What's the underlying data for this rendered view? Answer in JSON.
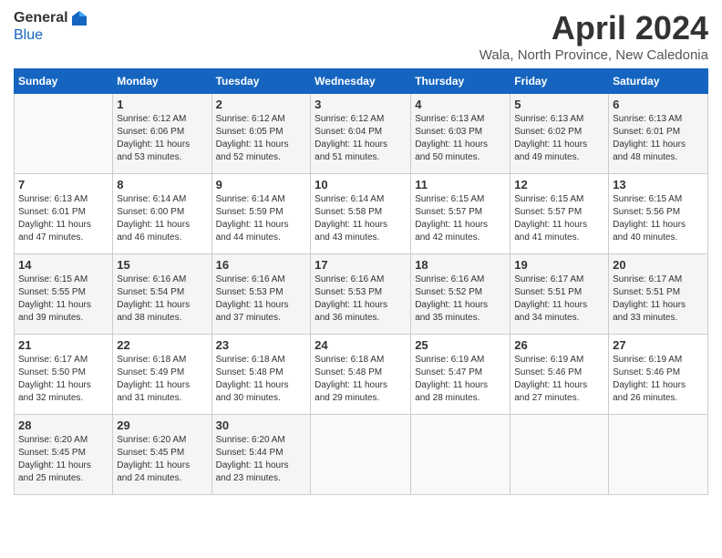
{
  "header": {
    "logo_general": "General",
    "logo_blue": "Blue",
    "month_title": "April 2024",
    "location": "Wala, North Province, New Caledonia"
  },
  "days_of_week": [
    "Sunday",
    "Monday",
    "Tuesday",
    "Wednesday",
    "Thursday",
    "Friday",
    "Saturday"
  ],
  "weeks": [
    [
      {
        "day": "",
        "info": ""
      },
      {
        "day": "1",
        "info": "Sunrise: 6:12 AM\nSunset: 6:06 PM\nDaylight: 11 hours\nand 53 minutes."
      },
      {
        "day": "2",
        "info": "Sunrise: 6:12 AM\nSunset: 6:05 PM\nDaylight: 11 hours\nand 52 minutes."
      },
      {
        "day": "3",
        "info": "Sunrise: 6:12 AM\nSunset: 6:04 PM\nDaylight: 11 hours\nand 51 minutes."
      },
      {
        "day": "4",
        "info": "Sunrise: 6:13 AM\nSunset: 6:03 PM\nDaylight: 11 hours\nand 50 minutes."
      },
      {
        "day": "5",
        "info": "Sunrise: 6:13 AM\nSunset: 6:02 PM\nDaylight: 11 hours\nand 49 minutes."
      },
      {
        "day": "6",
        "info": "Sunrise: 6:13 AM\nSunset: 6:01 PM\nDaylight: 11 hours\nand 48 minutes."
      }
    ],
    [
      {
        "day": "7",
        "info": "Sunrise: 6:13 AM\nSunset: 6:01 PM\nDaylight: 11 hours\nand 47 minutes."
      },
      {
        "day": "8",
        "info": "Sunrise: 6:14 AM\nSunset: 6:00 PM\nDaylight: 11 hours\nand 46 minutes."
      },
      {
        "day": "9",
        "info": "Sunrise: 6:14 AM\nSunset: 5:59 PM\nDaylight: 11 hours\nand 44 minutes."
      },
      {
        "day": "10",
        "info": "Sunrise: 6:14 AM\nSunset: 5:58 PM\nDaylight: 11 hours\nand 43 minutes."
      },
      {
        "day": "11",
        "info": "Sunrise: 6:15 AM\nSunset: 5:57 PM\nDaylight: 11 hours\nand 42 minutes."
      },
      {
        "day": "12",
        "info": "Sunrise: 6:15 AM\nSunset: 5:57 PM\nDaylight: 11 hours\nand 41 minutes."
      },
      {
        "day": "13",
        "info": "Sunrise: 6:15 AM\nSunset: 5:56 PM\nDaylight: 11 hours\nand 40 minutes."
      }
    ],
    [
      {
        "day": "14",
        "info": "Sunrise: 6:15 AM\nSunset: 5:55 PM\nDaylight: 11 hours\nand 39 minutes."
      },
      {
        "day": "15",
        "info": "Sunrise: 6:16 AM\nSunset: 5:54 PM\nDaylight: 11 hours\nand 38 minutes."
      },
      {
        "day": "16",
        "info": "Sunrise: 6:16 AM\nSunset: 5:53 PM\nDaylight: 11 hours\nand 37 minutes."
      },
      {
        "day": "17",
        "info": "Sunrise: 6:16 AM\nSunset: 5:53 PM\nDaylight: 11 hours\nand 36 minutes."
      },
      {
        "day": "18",
        "info": "Sunrise: 6:16 AM\nSunset: 5:52 PM\nDaylight: 11 hours\nand 35 minutes."
      },
      {
        "day": "19",
        "info": "Sunrise: 6:17 AM\nSunset: 5:51 PM\nDaylight: 11 hours\nand 34 minutes."
      },
      {
        "day": "20",
        "info": "Sunrise: 6:17 AM\nSunset: 5:51 PM\nDaylight: 11 hours\nand 33 minutes."
      }
    ],
    [
      {
        "day": "21",
        "info": "Sunrise: 6:17 AM\nSunset: 5:50 PM\nDaylight: 11 hours\nand 32 minutes."
      },
      {
        "day": "22",
        "info": "Sunrise: 6:18 AM\nSunset: 5:49 PM\nDaylight: 11 hours\nand 31 minutes."
      },
      {
        "day": "23",
        "info": "Sunrise: 6:18 AM\nSunset: 5:48 PM\nDaylight: 11 hours\nand 30 minutes."
      },
      {
        "day": "24",
        "info": "Sunrise: 6:18 AM\nSunset: 5:48 PM\nDaylight: 11 hours\nand 29 minutes."
      },
      {
        "day": "25",
        "info": "Sunrise: 6:19 AM\nSunset: 5:47 PM\nDaylight: 11 hours\nand 28 minutes."
      },
      {
        "day": "26",
        "info": "Sunrise: 6:19 AM\nSunset: 5:46 PM\nDaylight: 11 hours\nand 27 minutes."
      },
      {
        "day": "27",
        "info": "Sunrise: 6:19 AM\nSunset: 5:46 PM\nDaylight: 11 hours\nand 26 minutes."
      }
    ],
    [
      {
        "day": "28",
        "info": "Sunrise: 6:20 AM\nSunset: 5:45 PM\nDaylight: 11 hours\nand 25 minutes."
      },
      {
        "day": "29",
        "info": "Sunrise: 6:20 AM\nSunset: 5:45 PM\nDaylight: 11 hours\nand 24 minutes."
      },
      {
        "day": "30",
        "info": "Sunrise: 6:20 AM\nSunset: 5:44 PM\nDaylight: 11 hours\nand 23 minutes."
      },
      {
        "day": "",
        "info": ""
      },
      {
        "day": "",
        "info": ""
      },
      {
        "day": "",
        "info": ""
      },
      {
        "day": "",
        "info": ""
      }
    ]
  ]
}
